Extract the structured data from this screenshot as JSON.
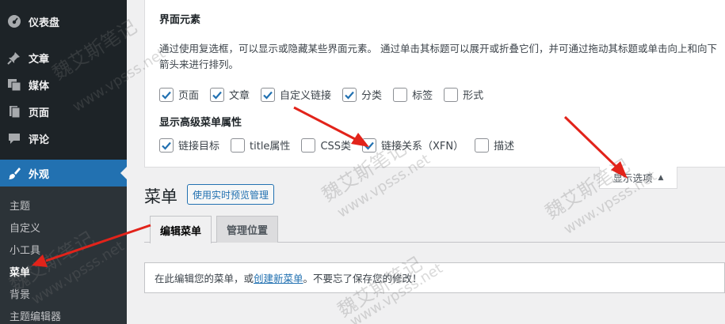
{
  "sidebar": {
    "items": [
      {
        "label": "仪表盘",
        "icon": "dashboard-icon"
      },
      {
        "label": "文章",
        "icon": "pin-icon"
      },
      {
        "label": "媒体",
        "icon": "media-icon"
      },
      {
        "label": "页面",
        "icon": "page-icon"
      },
      {
        "label": "评论",
        "icon": "comment-icon"
      },
      {
        "label": "外观",
        "icon": "paintbrush-icon"
      }
    ],
    "submenu": [
      "主题",
      "自定义",
      "小工具",
      "菜单",
      "背景",
      "主题编辑器"
    ]
  },
  "screen_options": {
    "title": "界面元素",
    "description": "通过使用复选框，可以显示或隐藏某些界面元素。 通过单击其标题可以展开或折叠它们，并可通过拖动其标题或单击向上和向下箭头来进行排列。",
    "boxes": [
      {
        "label": "页面",
        "checked": true
      },
      {
        "label": "文章",
        "checked": true
      },
      {
        "label": "自定义链接",
        "checked": true
      },
      {
        "label": "分类",
        "checked": true
      },
      {
        "label": "标签",
        "checked": false
      },
      {
        "label": "形式",
        "checked": false
      }
    ],
    "advanced_title": "显示高级菜单属性",
    "advanced": [
      {
        "label": "链接目标",
        "checked": true
      },
      {
        "label": "title属性",
        "checked": false
      },
      {
        "label": "CSS类",
        "checked": false
      },
      {
        "label": "链接关系（XFN）",
        "checked": true
      },
      {
        "label": "描述",
        "checked": false
      }
    ],
    "toggle_label": "显示选项",
    "toggle_arrow": "▲"
  },
  "page": {
    "title": "菜单",
    "live_button": "使用实时预览管理",
    "tabs": [
      "编辑菜单",
      "管理位置"
    ],
    "notice_prefix": "在此编辑您的菜单，或",
    "notice_link": "创建新菜单",
    "notice_suffix": "。不要忘了保存您的修改！"
  },
  "watermark": {
    "name": "魏艾斯笔记",
    "url": "www.vpsss.net"
  },
  "colors": {
    "sidebar_bg": "#1d2327",
    "accent": "#2271b1",
    "arrow": "#e2231a"
  }
}
